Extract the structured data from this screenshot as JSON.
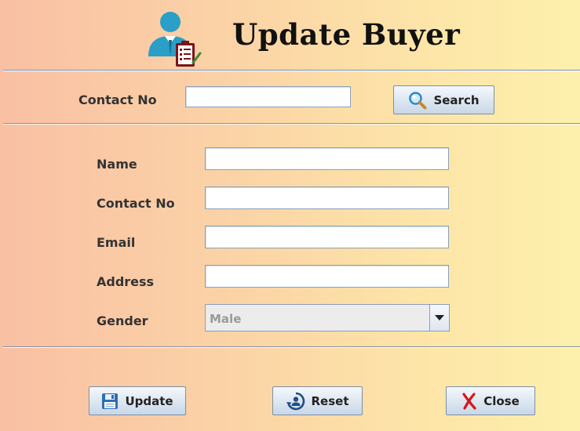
{
  "header": {
    "title": "Update Buyer",
    "icon": "buyer-update-icon"
  },
  "search": {
    "label": "Contact No",
    "value": "",
    "button_label": "Search",
    "button_icon": "magnifier-icon"
  },
  "form": {
    "name": {
      "label": "Name",
      "value": ""
    },
    "contact": {
      "label": "Contact No",
      "value": ""
    },
    "email": {
      "label": "Email",
      "value": ""
    },
    "address": {
      "label": "Address",
      "value": ""
    },
    "gender": {
      "label": "Gender",
      "selected": "Male",
      "options": [
        "Male"
      ]
    }
  },
  "actions": {
    "update_label": "Update",
    "reset_label": "Reset",
    "close_label": "Close"
  },
  "colors": {
    "accent": "#2aa0c8",
    "close_x": "#d8141c",
    "separator": "#7e8ea8"
  }
}
